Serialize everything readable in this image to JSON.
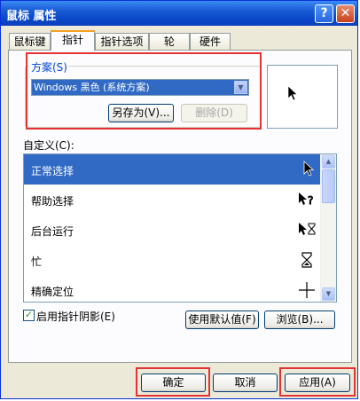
{
  "window": {
    "title": "鼠标 属性",
    "help_glyph": "?",
    "close_glyph": "✕"
  },
  "tabs": [
    {
      "label": "鼠标键"
    },
    {
      "label": "指针"
    },
    {
      "label": "指针选项"
    },
    {
      "label": "轮"
    },
    {
      "label": "硬件"
    }
  ],
  "scheme": {
    "group_label": "方案(S)",
    "selected": "Windows 黑色 (系统方案)",
    "save_as_label": "另存为(V)...",
    "delete_label": "删除(D)"
  },
  "customize": {
    "label": "自定义(C):",
    "items": [
      {
        "label": "正常选择",
        "icon": "arrow-cursor-icon"
      },
      {
        "label": "帮助选择",
        "icon": "help-cursor-icon"
      },
      {
        "label": "后台运行",
        "icon": "busy-background-cursor-icon"
      },
      {
        "label": "忙",
        "icon": "hourglass-cursor-icon"
      },
      {
        "label": "精确定位",
        "icon": "crosshair-cursor-icon"
      }
    ]
  },
  "shadow": {
    "label": "启用指针阴影(E)",
    "checked": true
  },
  "buttons": {
    "use_default": "使用默认值(F)",
    "browse": "浏览(B)...",
    "ok": "确定",
    "cancel": "取消",
    "apply": "应用(A)"
  },
  "colors": {
    "selection": "#316ac5",
    "highlight_box": "#e53232",
    "title_bar": "#0a48c9"
  }
}
